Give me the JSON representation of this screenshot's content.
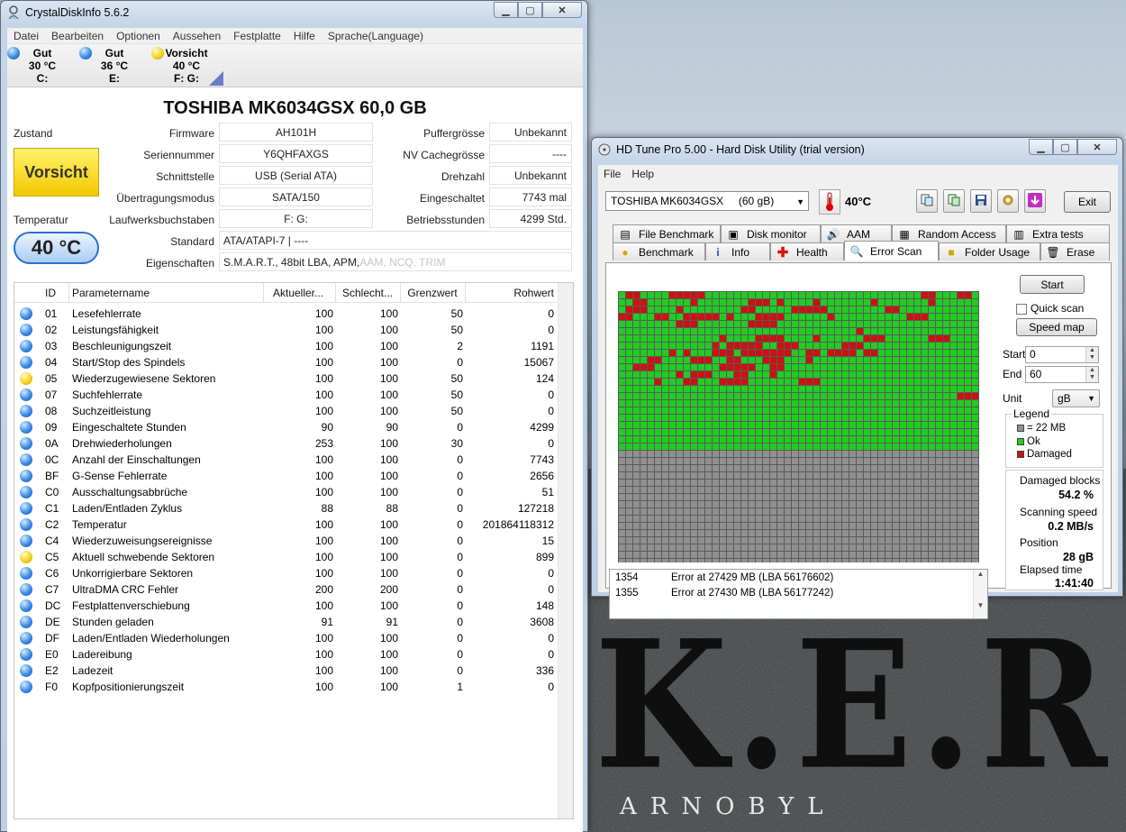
{
  "desktop": {
    "bg_text": "K.E.R.",
    "bg_subtext": "ARNOBYL"
  },
  "cdi": {
    "title": "CrystalDiskInfo 5.6.2",
    "menu": [
      "Datei",
      "Bearbeiten",
      "Optionen",
      "Aussehen",
      "Festplatte",
      "Hilfe",
      "Sprache(Language)"
    ],
    "drives": [
      {
        "status": "Gut",
        "temp": "30 °C",
        "letter": "C:",
        "color": "blue"
      },
      {
        "status": "Gut",
        "temp": "36 °C",
        "letter": "E:",
        "color": "blue"
      },
      {
        "status": "Vorsicht",
        "temp": "40 °C",
        "letter": "F: G:",
        "color": "yellow"
      }
    ],
    "model_title": "TOSHIBA MK6034GSX  60,0 GB",
    "state_label": "Zustand",
    "state_value": "Vorsicht",
    "temperature_label": "Temperatur",
    "temperature_value": "40 °C",
    "labels": {
      "firmware": "Firmware",
      "serial": "Seriennummer",
      "interface": "Schnittstelle",
      "transfer": "Übertragungsmodus",
      "letters": "Laufwerksbuchstaben",
      "standard": "Standard",
      "features": "Eigenschaften",
      "buffer": "Puffergrösse",
      "nvcache": "NV Cachegrösse",
      "rpm": "Drehzahl",
      "powercount": "Eingeschaltet",
      "hours": "Betriebsstunden"
    },
    "values": {
      "firmware": "AH101H",
      "serial": "Y6QHFAXGS",
      "interface": "USB (Serial ATA)",
      "transfer": "SATA/150",
      "letters": "F: G:",
      "standard": "ATA/ATAPI-7 | ----",
      "features_on": "S.M.A.R.T., 48bit LBA, APM, ",
      "features_off": "AAM, NCQ, TRIM",
      "buffer": "Unbekannt",
      "nvcache": "----",
      "rpm": "Unbekannt",
      "powercount": "7743 mal",
      "hours": "4299 Std."
    },
    "smart_headers": {
      "id": "ID",
      "name": "Parametername",
      "current": "Aktueller...",
      "worst": "Schlecht...",
      "threshold": "Grenzwert",
      "raw": "Rohwert"
    },
    "smart_rows": [
      {
        "s": "blue",
        "id": "01",
        "name": "Lesefehlerrate",
        "cur": "100",
        "wor": "100",
        "thr": "50",
        "raw": "0"
      },
      {
        "s": "blue",
        "id": "02",
        "name": "Leistungsfähigkeit",
        "cur": "100",
        "wor": "100",
        "thr": "50",
        "raw": "0"
      },
      {
        "s": "blue",
        "id": "03",
        "name": "Beschleunigungszeit",
        "cur": "100",
        "wor": "100",
        "thr": "2",
        "raw": "1191"
      },
      {
        "s": "blue",
        "id": "04",
        "name": "Start/Stop des Spindels",
        "cur": "100",
        "wor": "100",
        "thr": "0",
        "raw": "15067"
      },
      {
        "s": "yellow",
        "id": "05",
        "name": "Wiederzugewiesene Sektoren",
        "cur": "100",
        "wor": "100",
        "thr": "50",
        "raw": "124"
      },
      {
        "s": "blue",
        "id": "07",
        "name": "Suchfehlerrate",
        "cur": "100",
        "wor": "100",
        "thr": "50",
        "raw": "0"
      },
      {
        "s": "blue",
        "id": "08",
        "name": "Suchzeitleistung",
        "cur": "100",
        "wor": "100",
        "thr": "50",
        "raw": "0"
      },
      {
        "s": "blue",
        "id": "09",
        "name": "Eingeschaltete Stunden",
        "cur": "90",
        "wor": "90",
        "thr": "0",
        "raw": "4299"
      },
      {
        "s": "blue",
        "id": "0A",
        "name": "Drehwiederholungen",
        "cur": "253",
        "wor": "100",
        "thr": "30",
        "raw": "0"
      },
      {
        "s": "blue",
        "id": "0C",
        "name": "Anzahl der Einschaltungen",
        "cur": "100",
        "wor": "100",
        "thr": "0",
        "raw": "7743"
      },
      {
        "s": "blue",
        "id": "BF",
        "name": "G-Sense Fehlerrate",
        "cur": "100",
        "wor": "100",
        "thr": "0",
        "raw": "2656"
      },
      {
        "s": "blue",
        "id": "C0",
        "name": "Ausschaltungsabbrüche",
        "cur": "100",
        "wor": "100",
        "thr": "0",
        "raw": "51"
      },
      {
        "s": "blue",
        "id": "C1",
        "name": "Laden/Entladen Zyklus",
        "cur": "88",
        "wor": "88",
        "thr": "0",
        "raw": "127218"
      },
      {
        "s": "blue",
        "id": "C2",
        "name": "Temperatur",
        "cur": "100",
        "wor": "100",
        "thr": "0",
        "raw": "201864118312"
      },
      {
        "s": "blue",
        "id": "C4",
        "name": "Wiederzuweisungsereignisse",
        "cur": "100",
        "wor": "100",
        "thr": "0",
        "raw": "15"
      },
      {
        "s": "yellow",
        "id": "C5",
        "name": "Aktuell schwebende Sektoren",
        "cur": "100",
        "wor": "100",
        "thr": "0",
        "raw": "899"
      },
      {
        "s": "blue",
        "id": "C6",
        "name": "Unkorrigierbare Sektoren",
        "cur": "100",
        "wor": "100",
        "thr": "0",
        "raw": "0"
      },
      {
        "s": "blue",
        "id": "C7",
        "name": "UltraDMA CRC Fehler",
        "cur": "200",
        "wor": "200",
        "thr": "0",
        "raw": "0"
      },
      {
        "s": "blue",
        "id": "DC",
        "name": "Festplattenverschiebung",
        "cur": "100",
        "wor": "100",
        "thr": "0",
        "raw": "148"
      },
      {
        "s": "blue",
        "id": "DE",
        "name": "Stunden geladen",
        "cur": "91",
        "wor": "91",
        "thr": "0",
        "raw": "3608"
      },
      {
        "s": "blue",
        "id": "DF",
        "name": "Laden/Entladen Wiederholungen",
        "cur": "100",
        "wor": "100",
        "thr": "0",
        "raw": "0"
      },
      {
        "s": "blue",
        "id": "E0",
        "name": "Ladereibung",
        "cur": "100",
        "wor": "100",
        "thr": "0",
        "raw": "0"
      },
      {
        "s": "blue",
        "id": "E2",
        "name": "Ladezeit",
        "cur": "100",
        "wor": "100",
        "thr": "0",
        "raw": "336"
      },
      {
        "s": "blue",
        "id": "F0",
        "name": "Kopfpositionierungszeit",
        "cur": "100",
        "wor": "100",
        "thr": "1",
        "raw": "0"
      }
    ],
    "colors": {
      "ok": "#3a8be6",
      "warn": "#f5d21a"
    }
  },
  "hdt": {
    "title": "HD Tune Pro 5.00 - Hard Disk Utility (trial version)",
    "menu": [
      "File",
      "Help"
    ],
    "drive_combo": "TOSHIBA MK6034GSX     (60 gB)",
    "temperature": "40°C",
    "exit_label": "Exit",
    "tabs_row1": [
      "File Benchmark",
      "Disk monitor",
      "AAM",
      "Random Access",
      "Extra tests"
    ],
    "tabs_row2": [
      "Benchmark",
      "Info",
      "Health",
      "Error Scan",
      "Folder Usage",
      "Erase"
    ],
    "active_tab": "Error Scan",
    "start_label": "Start",
    "quick_scan_label": "Quick scan",
    "speed_map_label": "Speed map",
    "start_field_label": "Start",
    "start_value": "0",
    "end_field_label": "End",
    "end_value": "60",
    "unit_label": "Unit",
    "unit_value": "gB",
    "legend_title": "Legend",
    "legend_block": "= 22 MB",
    "legend_ok": "Ok",
    "legend_damaged": "Damaged",
    "damaged_blocks_label": "Damaged blocks",
    "damaged_blocks_value": "54.2 %",
    "scan_speed_label": "Scanning speed",
    "scan_speed_value": "0.2 MB/s",
    "position_label": "Position",
    "position_value": "28 gB",
    "elapsed_label": "Elapsed time",
    "elapsed_value": "1:41:40",
    "log": [
      {
        "n": "1354",
        "msg": "Error at 27429 MB (LBA 56176602)"
      },
      {
        "n": "1355",
        "msg": "Error at 27430 MB (LBA 56177242)"
      }
    ],
    "scan_grid": {
      "cols": 50,
      "rows": 50,
      "scanned_cells": 1100,
      "damaged_runs": [
        [
          0,
          1,
          2
        ],
        [
          0,
          7,
          5
        ],
        [
          0,
          42,
          2
        ],
        [
          0,
          47,
          2
        ],
        [
          1,
          2,
          2
        ],
        [
          1,
          10,
          1
        ],
        [
          1,
          18,
          3
        ],
        [
          1,
          22,
          1
        ],
        [
          1,
          27,
          1
        ],
        [
          1,
          35,
          1
        ],
        [
          1,
          43,
          1
        ],
        [
          2,
          1,
          3
        ],
        [
          2,
          8,
          1
        ],
        [
          2,
          17,
          2
        ],
        [
          2,
          24,
          5
        ],
        [
          2,
          37,
          2
        ],
        [
          3,
          0,
          2
        ],
        [
          3,
          5,
          2
        ],
        [
          3,
          9,
          5
        ],
        [
          3,
          15,
          1
        ],
        [
          3,
          19,
          4
        ],
        [
          3,
          29,
          1
        ],
        [
          3,
          40,
          3
        ],
        [
          4,
          8,
          3
        ],
        [
          4,
          18,
          4
        ],
        [
          5,
          33,
          1
        ],
        [
          6,
          14,
          1
        ],
        [
          6,
          19,
          4
        ],
        [
          6,
          27,
          1
        ],
        [
          6,
          34,
          3
        ],
        [
          6,
          43,
          3
        ],
        [
          7,
          13,
          1
        ],
        [
          7,
          15,
          5
        ],
        [
          7,
          22,
          3
        ],
        [
          7,
          31,
          3
        ],
        [
          8,
          7,
          1
        ],
        [
          8,
          9,
          1
        ],
        [
          8,
          13,
          3
        ],
        [
          8,
          17,
          7
        ],
        [
          8,
          26,
          2
        ],
        [
          8,
          29,
          4
        ],
        [
          8,
          34,
          2
        ],
        [
          9,
          4,
          2
        ],
        [
          9,
          10,
          3
        ],
        [
          9,
          15,
          2
        ],
        [
          9,
          20,
          3
        ],
        [
          9,
          26,
          1
        ],
        [
          10,
          2,
          3
        ],
        [
          10,
          14,
          5
        ],
        [
          10,
          21,
          2
        ],
        [
          11,
          8,
          1
        ],
        [
          11,
          10,
          3
        ],
        [
          11,
          16,
          2
        ],
        [
          11,
          21,
          1
        ],
        [
          12,
          5,
          1
        ],
        [
          12,
          9,
          2
        ],
        [
          12,
          14,
          4
        ],
        [
          12,
          25,
          3
        ],
        [
          14,
          47,
          3
        ]
      ]
    },
    "colors": {
      "ok": "#22cc22",
      "damaged": "#cc1111",
      "unscanned": "#909090"
    }
  }
}
